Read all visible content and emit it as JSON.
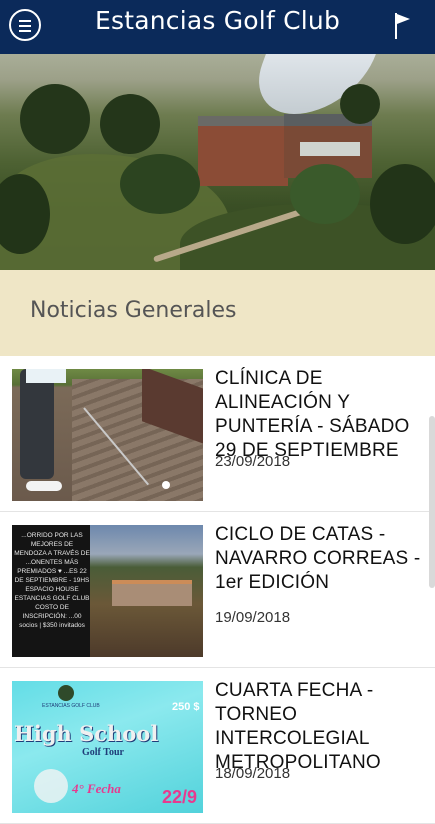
{
  "header": {
    "title": "Estancias Golf Club",
    "menu_icon": "menu-icon",
    "flag_icon": "flag-icon",
    "background": "#0b2a5a"
  },
  "section": {
    "title": "Noticias Generales",
    "background": "#efe6c6"
  },
  "news": [
    {
      "title": "CLÍNICA DE ALINEACIÓN Y PUNTERÍA - SÁBADO 29 DE SEPTIEMBRE",
      "date": "23/09/2018"
    },
    {
      "title": "CICLO DE CATAS - NAVARRO CORREAS - 1er EDICIÓN",
      "date": "19/09/2018",
      "thumb_text": "...ORRIDO POR LAS MEJORES DE MENDOZA A TRAVÉS DE ...ONENTES MÁS PREMIADOS ♥ ...ES 22 DE SEPTIEMBRE - 19HS ESPACIO HOUSE ESTANCIAS GOLF CLUB COSTO DE INSCRIPCIÓN: ...00 socios | $350 invitados"
    },
    {
      "title": "CUARTA FECHA - TORNEO INTERCOLEGIAL METROPOLITANO",
      "date": "18/09/2018",
      "thumb_logo": "ESTANCIAS GOLF CLUB",
      "thumb_heading": "High School",
      "thumb_sub": "Golf Tour",
      "thumb_price": "250 $",
      "thumb_fecha": "4° Fecha",
      "thumb_num": "22/9"
    }
  ]
}
